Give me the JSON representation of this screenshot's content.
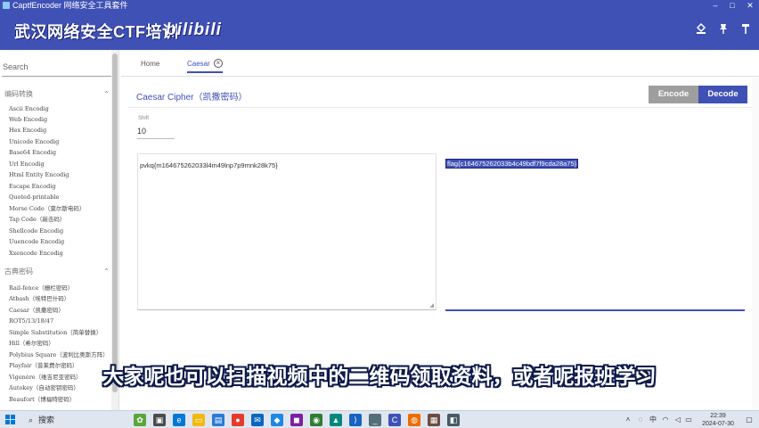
{
  "window": {
    "title": "CaptfEncoder 网络安全工具套件",
    "icon": "app-icon"
  },
  "header": {
    "title": "武汉网络安全CTF培训",
    "logo": "bilibili",
    "icons": [
      "paint-bucket-icon",
      "pin-icon",
      "hammer-icon"
    ]
  },
  "sidebar": {
    "search_placeholder": "Search",
    "groups": [
      {
        "label": "编码转换",
        "items": [
          "Ascii Encodig",
          "Web Encodig",
          "Hex Encodig",
          "Unicode Encodig",
          "Base64 Encodig",
          "Url Encodig",
          "Html Entity Encodig",
          "Escape Encodig",
          "Quoted-printable",
          "Morse Code（莫尔斯电码）",
          "Tap Code（敲击码）",
          "Shellcode Encodig",
          "Uuencode Encodig",
          "Xxencode Encodig"
        ]
      },
      {
        "label": "古典密码",
        "items": [
          "Rail-fence（栅栏密码）",
          "Atbash（埃特巴什码）",
          "Caesar（凯撒密码）",
          "ROT5/13/18/47",
          "Simple Substitution（简单替换）",
          "Hill（希尔密码）",
          "Polybius Square（波利比奥斯方阵）",
          "Playfair（普莱费尔密码）",
          "Vigenère（维吉尼亚密码）",
          "Autokey（自动密钥密码）",
          "Beaufort（博福特密码）"
        ]
      }
    ]
  },
  "tabs": [
    {
      "label": "Home",
      "active": false
    },
    {
      "label": "Caesar",
      "active": true
    }
  ],
  "cipher": {
    "title": "Caesar Cipher（凯撒密码）",
    "encode_label": "Encode",
    "decode_label": "Decode",
    "shift_label": "Shift",
    "shift_value": "10",
    "input_text": "pvkq{m164675262033l4m49lnp7p9mnk28k75}",
    "output_text": "flag{c164675262033b4c49bdf7f9cda28a75}"
  },
  "subtitle": "大家呢也可以扫描视频中的二维码领取资料，或者呢报班学习",
  "taskbar": {
    "search_label": "搜索",
    "time": "22:39",
    "date": "2024-07-30"
  },
  "colors": {
    "primary": "#3f51b5",
    "encode_button": "#9e9e9e",
    "selection": "#3f51b5"
  }
}
